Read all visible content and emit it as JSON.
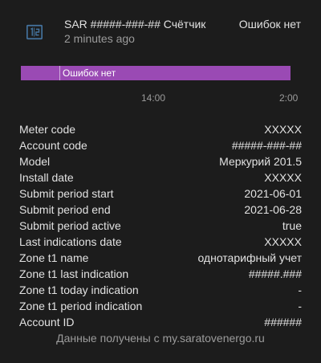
{
  "entity": {
    "icon": "counter-icon",
    "name": "SAR #####-###-## Счётчик",
    "last_changed": "2 minutes ago",
    "state": "Ошибок нет"
  },
  "history": {
    "bar_label": "Ошибок нет",
    "bar_color": "#9a4ab4",
    "axis_ticks": [
      "14:00",
      "2:00"
    ]
  },
  "attributes": [
    {
      "key": "Meter code",
      "value": "XXXXX"
    },
    {
      "key": "Account code",
      "value": "#####-###-##"
    },
    {
      "key": "Model",
      "value": "Меркурий 201.5"
    },
    {
      "key": "Install date",
      "value": "XXXXX"
    },
    {
      "key": "Submit period start",
      "value": "2021-06-01"
    },
    {
      "key": "Submit period end",
      "value": "2021-06-28"
    },
    {
      "key": "Submit period active",
      "value": "true"
    },
    {
      "key": "Last indications date",
      "value": "XXXXX"
    },
    {
      "key": "Zone t1 name",
      "value": "однотарифный учет"
    },
    {
      "key": "Zone t1 last indication",
      "value": "#####.###"
    },
    {
      "key": "Zone t1 today indication",
      "value": "-"
    },
    {
      "key": "Zone t1 period indication",
      "value": "-"
    },
    {
      "key": "Account ID",
      "value": "######"
    }
  ],
  "attribution": "Данные получены с my.saratovenergo.ru",
  "colors": {
    "background": "#1c1c1c",
    "icon": "#44739e",
    "primary_text": "#e1e1e1",
    "secondary_text": "#9b9b9b"
  }
}
